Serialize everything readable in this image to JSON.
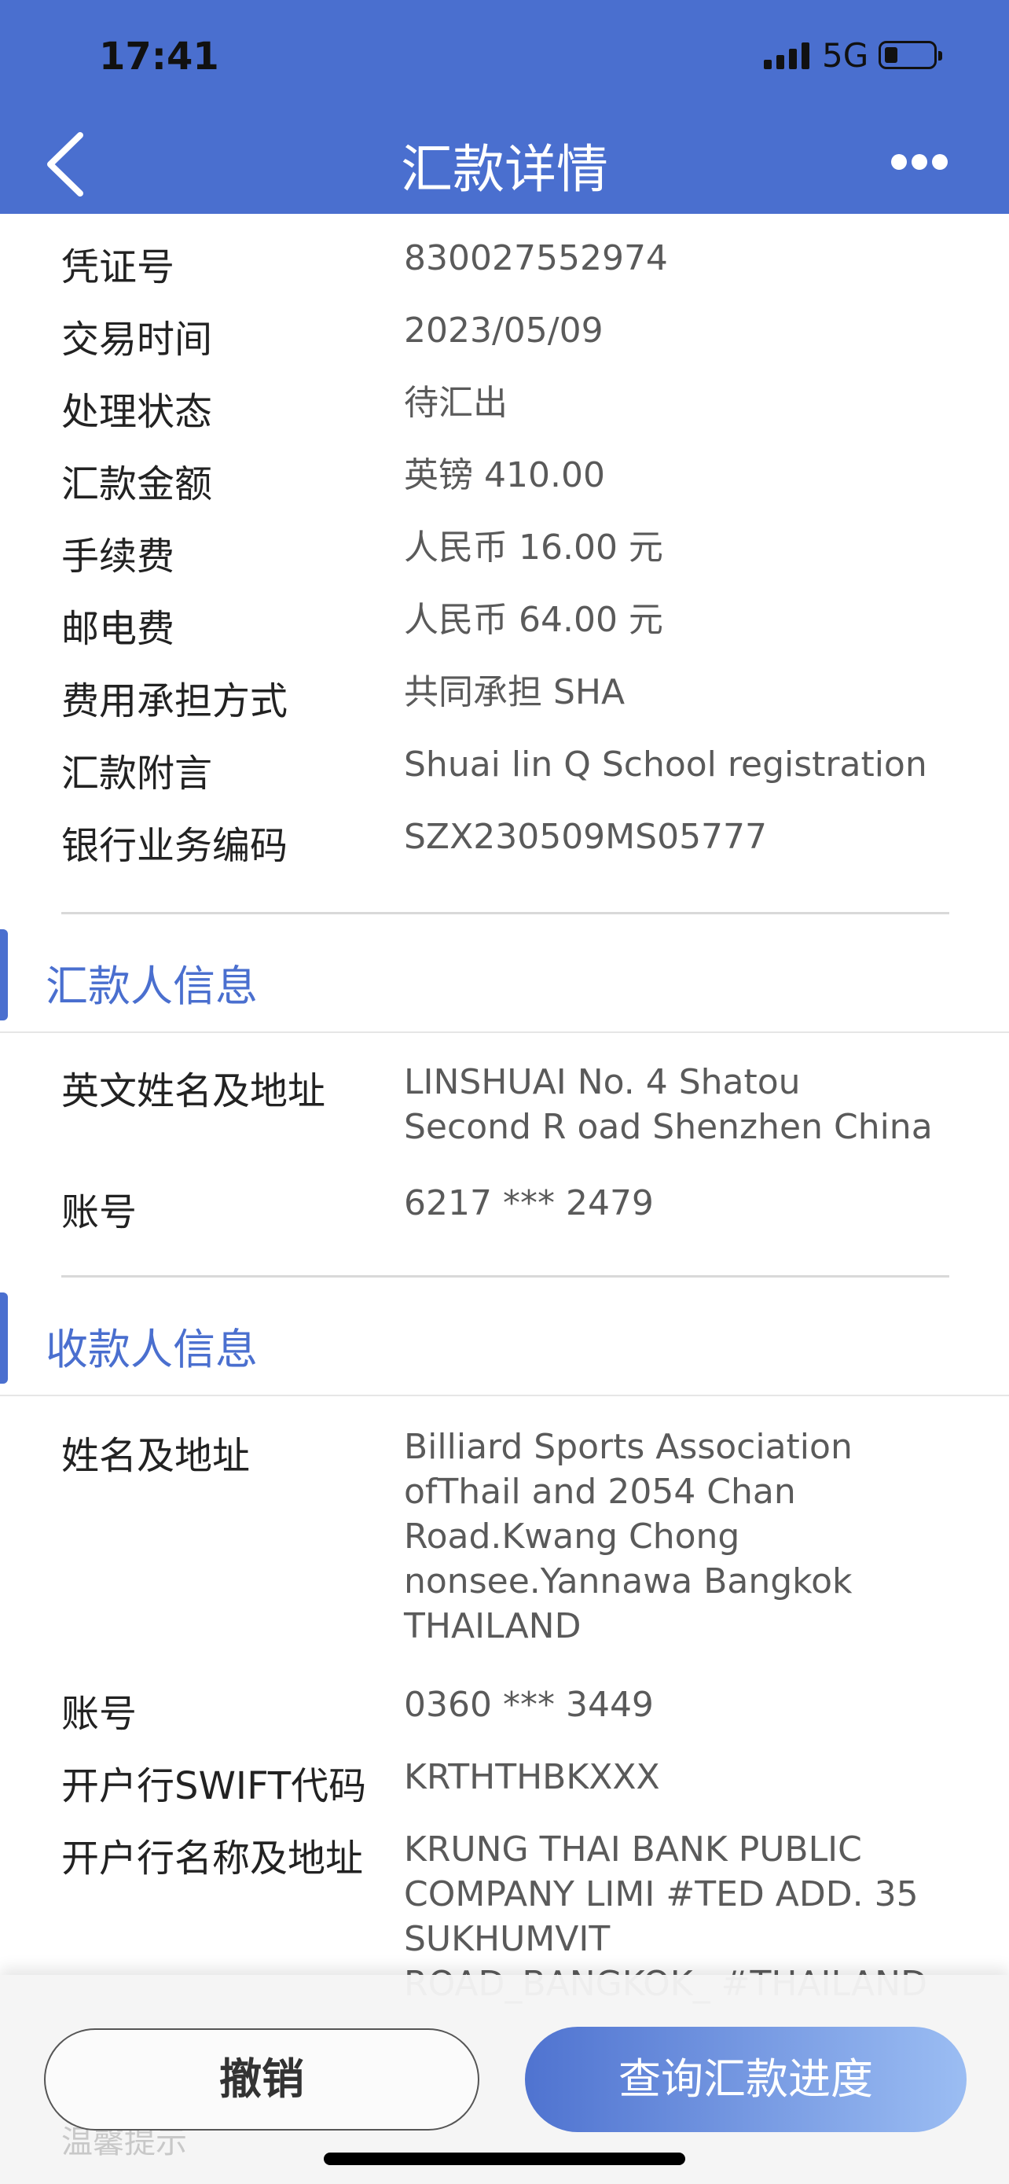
{
  "status": {
    "time": "17:41",
    "network": "5G"
  },
  "nav": {
    "title": "汇款详情"
  },
  "details": [
    {
      "label": "凭证号",
      "value": "830027552974"
    },
    {
      "label": "交易时间",
      "value": "2023/05/09"
    },
    {
      "label": "处理状态",
      "value": "待汇出"
    },
    {
      "label": "汇款金额",
      "value": "英镑 410.00"
    },
    {
      "label": "手续费",
      "value": "人民币 16.00 元"
    },
    {
      "label": "邮电费",
      "value": "人民币 64.00 元"
    },
    {
      "label": "费用承担方式",
      "value": "共同承担 SHA"
    },
    {
      "label": "汇款附言",
      "value": "Shuai lin Q School registration"
    },
    {
      "label": "银行业务编码",
      "value": "SZX230509MS05777"
    }
  ],
  "remitter": {
    "section_title": "汇款人信息",
    "rows": [
      {
        "label": "英文姓名及地址",
        "value": "LINSHUAI  No. 4 Shatou\nSecond R oad Shenzhen China"
      },
      {
        "label": "账号",
        "value": "6217 *** 2479"
      }
    ]
  },
  "payee": {
    "section_title": "收款人信息",
    "rows": [
      {
        "label": "姓名及地址",
        "value": "Billiard Sports Association\nofThail and  2054 Chan\nRoad.Kwang Chong\nnonsee.Yannawa Bangkok\nTHAILAND"
      },
      {
        "label": "账号",
        "value": "0360 *** 3449"
      },
      {
        "label": "开户行SWIFT代码",
        "value": "KRTHTHBKXXX"
      },
      {
        "label": "开户行名称及地址",
        "value": "KRUNG THAI BANK PUBLIC\nCOMPANY LIMI #TED ADD. 35\nSUKHUMVIT\nROAD_BANGKOK_ #THAILAND"
      }
    ]
  },
  "actions": {
    "cancel_label": "撤销",
    "query_label": "查询汇款进度",
    "tip": "温馨提示"
  },
  "colors": {
    "brand": "#4a6fcf"
  }
}
